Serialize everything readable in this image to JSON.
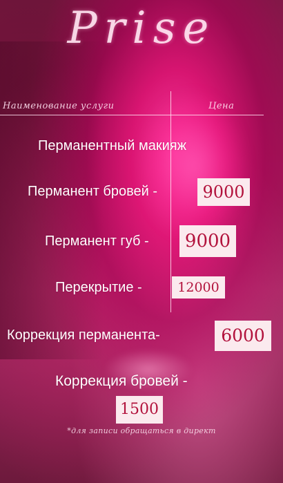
{
  "title": "Prise",
  "header": {
    "service_column": "Наименование услуги",
    "price_column": "Цена"
  },
  "section_title": "Перманентный макияж",
  "services": [
    {
      "name": "Перманент бровей -",
      "price": "9000"
    },
    {
      "name": "Перманент губ -",
      "price": "9000"
    },
    {
      "name": "Перекрытие -",
      "price": "12000"
    },
    {
      "name": "Коррекция перманента-",
      "price": "6000"
    },
    {
      "name": "Коррекция бровей -",
      "price": "1500"
    }
  ],
  "footnote": "*для записи обращаться в директ",
  "colors": {
    "background": "#9b1e56",
    "price_box": "#fbeaee",
    "price_text": "#b2123c",
    "text": "#ffffff"
  }
}
